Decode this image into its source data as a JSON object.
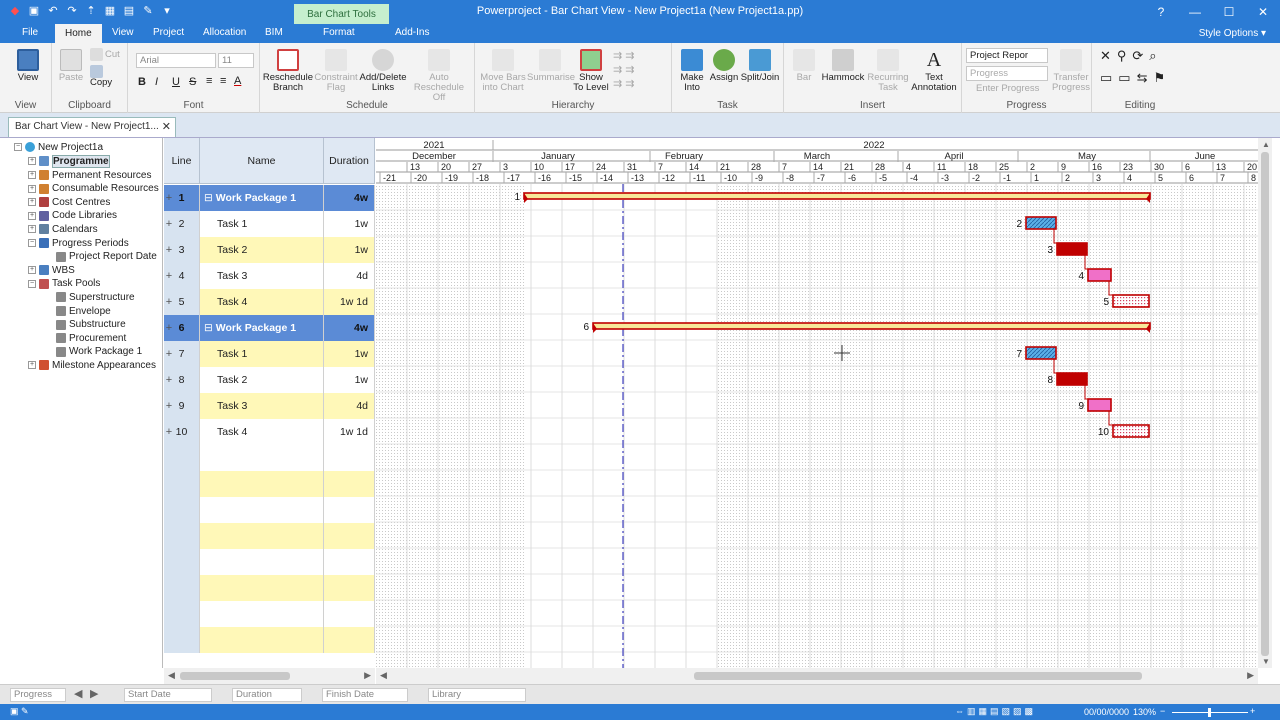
{
  "app": {
    "title": "Powerproject - Bar Chart View - New Project1a (New Project1a.pp)",
    "contextual_tab": "Bar Chart Tools",
    "tabs": [
      "File",
      "Home",
      "View",
      "Project",
      "Allocation",
      "BIM",
      "Format",
      "Add-Ins"
    ],
    "active_tab": "Home",
    "style_options": "Style Options ▾"
  },
  "ribbon": {
    "view": {
      "label": "View",
      "group": "View"
    },
    "clipboard": {
      "paste": "Paste",
      "cut": "Cut",
      "copy": "Copy",
      "group": "Clipboard"
    },
    "font": {
      "name": "Arial",
      "size": "11",
      "group": "Font"
    },
    "schedule": {
      "reschedule": "Reschedule Branch",
      "constraint": "Constraint Flag",
      "addlinks": "Add/Delete Links",
      "auto": "Auto Reschedule Off",
      "group": "Schedule"
    },
    "hierarchy": {
      "movebars": "Move Bars into Chart",
      "summarise": "Summarise",
      "showto": "Show To Level",
      "group": "Hierarchy"
    },
    "task": {
      "makeinto": "Make Into",
      "assign": "Assign",
      "splitjoin": "Split/Join",
      "group": "Task"
    },
    "insert": {
      "bar": "Bar",
      "hammock": "Hammock",
      "recurring": "Recurring Task",
      "textann": "Text Annotation",
      "group": "Insert"
    },
    "progress": {
      "report": "Project Repor",
      "progress": "Progress",
      "enter": "Enter Progress",
      "transfer": "Transfer Progress",
      "group": "Progress"
    },
    "editing": {
      "group": "Editing"
    }
  },
  "doc_tab": "Bar Chart View - New Project1...",
  "tree": {
    "root": "New Project1a",
    "items": [
      "Programme",
      "Permanent Resources",
      "Consumable Resources",
      "Cost Centres",
      "Code Libraries",
      "Calendars",
      "Progress Periods",
      "Project Report Date",
      "WBS",
      "Task Pools",
      "Superstructure",
      "Envelope",
      "Substructure",
      "Procurement",
      "Work Package 1",
      "Milestone Appearances"
    ]
  },
  "grid": {
    "headers": {
      "line": "Line",
      "name": "Name",
      "duration": "Duration"
    },
    "rows": [
      {
        "line": "1",
        "name": "Work Package 1",
        "duration": "4w",
        "summary": true
      },
      {
        "line": "2",
        "name": "Task 1",
        "duration": "1w"
      },
      {
        "line": "3",
        "name": "Task 2",
        "duration": "1w"
      },
      {
        "line": "4",
        "name": "Task 3",
        "duration": "4d"
      },
      {
        "line": "5",
        "name": "Task 4",
        "duration": "1w 1d"
      },
      {
        "line": "6",
        "name": "Work Package 1",
        "duration": "4w",
        "summary": true
      },
      {
        "line": "7",
        "name": "Task 1",
        "duration": "1w"
      },
      {
        "line": "8",
        "name": "Task 2",
        "duration": "1w"
      },
      {
        "line": "9",
        "name": "Task 3",
        "duration": "4d"
      },
      {
        "line": "10",
        "name": "Task 4",
        "duration": "1w 1d"
      }
    ]
  },
  "timescale": {
    "years": [
      "2021",
      "2022"
    ],
    "months": [
      "December",
      "January",
      "February",
      "March",
      "April",
      "May",
      "June"
    ],
    "days": [
      "13",
      "20",
      "27",
      "3",
      "10",
      "17",
      "24",
      "31",
      "7",
      "14",
      "21",
      "28",
      "7",
      "14",
      "21",
      "28",
      "4",
      "11",
      "18",
      "25",
      "2",
      "9",
      "16",
      "23",
      "30",
      "6",
      "13",
      "20"
    ],
    "weeks": [
      "-21",
      "-20",
      "-19",
      "-18",
      "-17",
      "-16",
      "-15",
      "-14",
      "-13",
      "-12",
      "-11",
      "-10",
      "-9",
      "-8",
      "-7",
      "-6",
      "-5",
      "-4",
      "-3",
      "-2",
      "-1",
      "1",
      "2",
      "3",
      "4",
      "5",
      "6",
      "7",
      "8"
    ]
  },
  "bars": [
    {
      "label": "1",
      "kind": "summary"
    },
    {
      "label": "2",
      "kind": "task",
      "style": "hatch-blue"
    },
    {
      "label": "3",
      "kind": "task",
      "style": "solid-red"
    },
    {
      "label": "4",
      "kind": "task",
      "style": "pink"
    },
    {
      "label": "5",
      "kind": "task",
      "style": "dots"
    },
    {
      "label": "6",
      "kind": "summary"
    },
    {
      "label": "7",
      "kind": "task",
      "style": "hatch-blue"
    },
    {
      "label": "8",
      "kind": "task",
      "style": "solid-red"
    },
    {
      "label": "9",
      "kind": "task",
      "style": "pink"
    },
    {
      "label": "10",
      "kind": "task",
      "style": "dots"
    }
  ],
  "bottom": {
    "progress": "Progress",
    "start": "Start Date",
    "duration": "Duration",
    "finish": "Finish Date",
    "library": "Library"
  },
  "status": {
    "date": "00/00/0000",
    "zoom": "130%"
  },
  "colors": {
    "accent": "#2b7bd4",
    "summary_row": "#5b8bd6",
    "task_row": "#fff8b8",
    "bar_red": "#c00000"
  }
}
